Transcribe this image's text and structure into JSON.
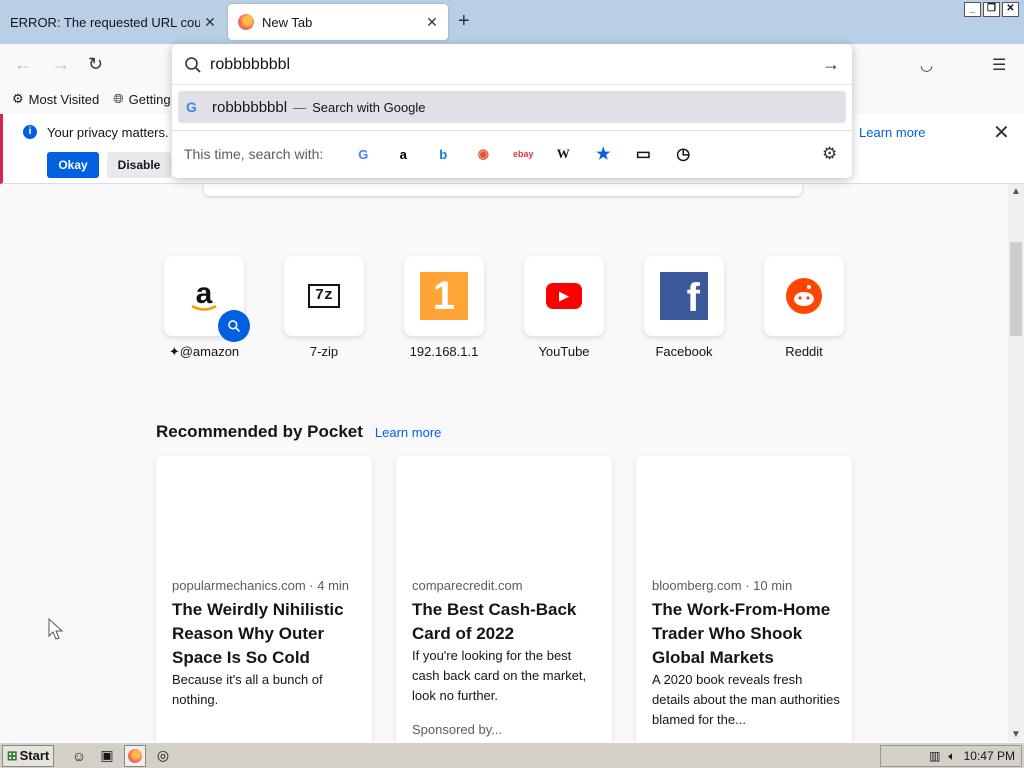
{
  "tabs": [
    {
      "title": "ERROR: The requested URL could not be retrieved",
      "active": false
    },
    {
      "title": "New Tab",
      "active": true
    }
  ],
  "urlbar": {
    "value": "robbbbbbbl",
    "suggestion_query": "robbbbbbbl",
    "suggestion_dash": "—",
    "suggestion_action": "Search with Google",
    "oneoff_label": "This time, search with:",
    "engines": [
      {
        "name": "google-icon",
        "glyph": "G",
        "color": "#4285f4"
      },
      {
        "name": "amazon-icon",
        "glyph": "a",
        "color": "#000000"
      },
      {
        "name": "bing-icon",
        "glyph": "b",
        "color": "#0f7dd6"
      },
      {
        "name": "duckduckgo-icon",
        "glyph": "◉",
        "color": "#de5833"
      },
      {
        "name": "ebay-icon",
        "glyph": "ebay",
        "color": "#e53238"
      },
      {
        "name": "wikipedia-icon",
        "glyph": "W",
        "color": "#000000"
      },
      {
        "name": "bookmarks-star-icon",
        "glyph": "★",
        "color": "#0060df"
      },
      {
        "name": "tabs-icon",
        "glyph": "▭",
        "color": "#333333"
      },
      {
        "name": "history-clock-icon",
        "glyph": "◷",
        "color": "#333333"
      }
    ]
  },
  "bookmarks": {
    "most_visited": "Most Visited",
    "getting_started": "Getting Started"
  },
  "notice": {
    "message": "Your privacy matters. F",
    "okay": "Okay",
    "disable": "Disable",
    "learn_more": "Learn more"
  },
  "tiles": [
    {
      "label": "@amazon",
      "icon": "amazon-logo-icon"
    },
    {
      "label": "7-zip",
      "icon": "7zip-logo-icon"
    },
    {
      "label": "192.168.1.1",
      "icon": "router-logo-icon"
    },
    {
      "label": "YouTube",
      "icon": "youtube-logo-icon"
    },
    {
      "label": "Facebook",
      "icon": "facebook-logo-icon"
    },
    {
      "label": "Reddit",
      "icon": "reddit-logo-icon"
    }
  ],
  "pocket": {
    "heading": "Recommended by Pocket",
    "learn_more": "Learn more",
    "cards": [
      {
        "source": "popularmechanics.com · 4 min",
        "title": "The Weirdly Nihilistic Reason Why Outer Space Is So Cold",
        "excerpt": "Because it's all a bunch of nothing."
      },
      {
        "source": "comparecredit.com",
        "title": "The Best Cash-Back Card of 2022",
        "excerpt": "If you're looking for the best cash back card on the market, look no further.",
        "sponsored": "Sponsored by..."
      },
      {
        "source": "bloomberg.com · 10 min",
        "title": "The Work-From-Home Trader Who Shook Global Markets",
        "excerpt": "A 2020 book reveals fresh details about the man authorities blamed for the..."
      }
    ]
  },
  "taskbar": {
    "start": "Start",
    "clock": "10:47 PM"
  },
  "colors": {
    "accent": "#0060df",
    "tabbar": "#b9cfe6"
  }
}
